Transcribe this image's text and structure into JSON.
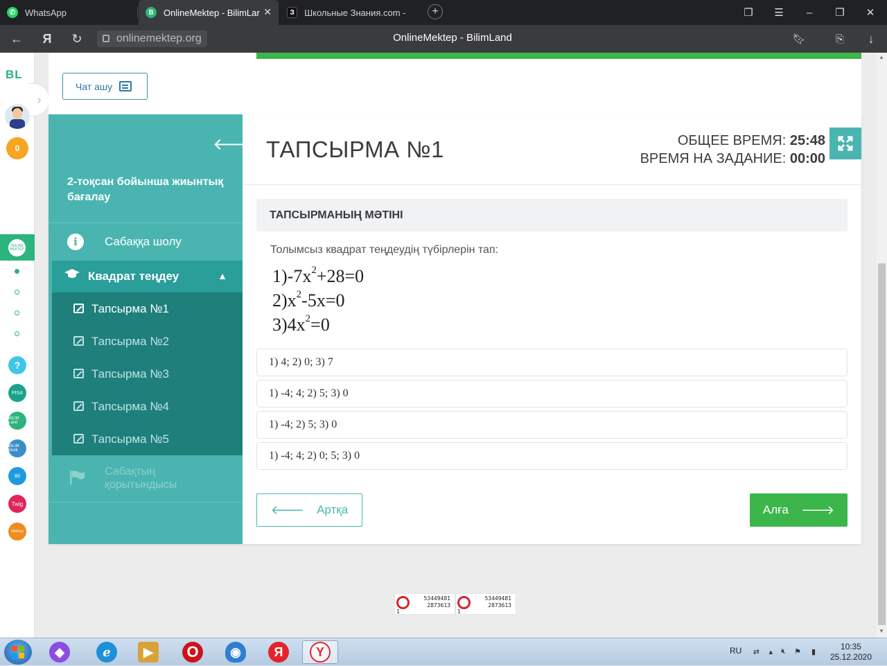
{
  "browser": {
    "tabs": [
      {
        "label": "WhatsApp",
        "icon": "whatsapp-icon"
      },
      {
        "label": "OnlineMektep - BilimLar",
        "icon": "bilimland-icon",
        "active": true
      },
      {
        "label": "Школьные Знания.com - ",
        "icon": "znaniya-icon",
        "fav_letter": "З"
      }
    ],
    "fav_letter_online": "B",
    "url": "onlinemektep.org",
    "page_title": "OnlineMektep - BilimLand"
  },
  "rail": {
    "logo": "BL",
    "coins": "0",
    "active_app_label": "ONLINE MEKTEP",
    "apps": [
      {
        "label": "?",
        "color": "#3ec7e6"
      },
      {
        "label": "PISA",
        "color": "#1aa38a"
      },
      {
        "label": "BILIM Land",
        "color": "#2db37d"
      },
      {
        "label": "BILIM Book",
        "color": "#3a8fc7"
      },
      {
        "label": "Bil",
        "color": "#1f9ae0"
      },
      {
        "label": "Twig",
        "color": "#e0245e"
      },
      {
        "label": "iMektep",
        "color": "#f08c1e"
      }
    ]
  },
  "chat": {
    "label": "Чат ашу"
  },
  "sidebar": {
    "title": "2-тоқсан бойынша жиынтық бағалау",
    "overview": "Сабаққа шолу",
    "section": "Квадрат теңдеу",
    "tasks": [
      "Тапсырма №1",
      "Тапсырма №2",
      "Тапсырма №3",
      "Тапсырма №4",
      "Тапсырма №5"
    ],
    "conclusion": "Сабақтың қорытындысы"
  },
  "task": {
    "title": "ТАПСЫРМА №1",
    "total_time_label": "ОБЩЕЕ ВРЕМЯ:",
    "total_time": "25:48",
    "task_time_label": "ВРЕМЯ НА ЗАДАНИЕ:",
    "task_time": "00:00",
    "header": "ТАПСЫРМАНЫҢ МӘТІНІ",
    "question": "Толымсыз квадрат теңдеудің түбірлерін тап:",
    "equations": [
      {
        "pre": "1)-7x",
        "sup": "2",
        "post": "+28=0"
      },
      {
        "pre": "2)x",
        "sup": "2",
        "post": "-5x=0"
      },
      {
        "pre": "3)4x",
        "sup": "2",
        "post": "=0"
      }
    ],
    "options": [
      "1) 4; 2) 0; 3) 7",
      "1) -4; 4; 2) 5; 3) 0",
      "1) -4; 2) 5; 3) 0",
      "1) -4; 4; 2) 0; 5; 3) 0"
    ],
    "back_label": "Артқа",
    "next_label": "Алға"
  },
  "counters": [
    {
      "n1": "53449481",
      "n2": "2873613",
      "n3": "1"
    },
    {
      "n1": "53449481",
      "n2": "2873613",
      "n3": "1"
    }
  ],
  "taskbar": {
    "lang": "RU",
    "time": "10:35",
    "date": "25.12.2020"
  }
}
